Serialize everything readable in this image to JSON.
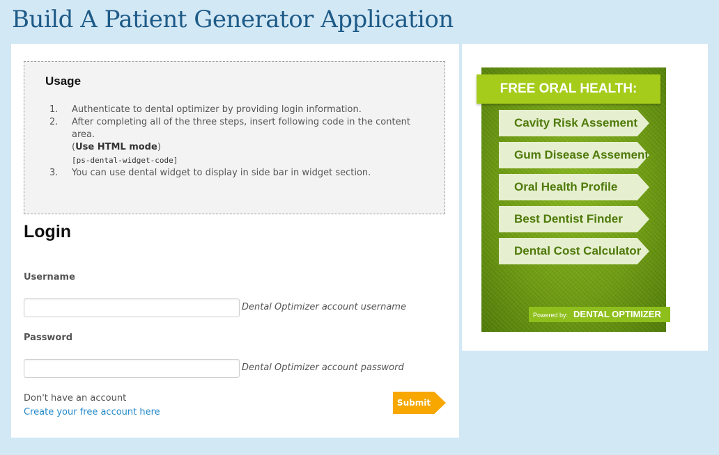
{
  "page": {
    "title": "Build A Patient Generator Application"
  },
  "usage": {
    "title": "Usage",
    "steps": [
      {
        "num": "1.",
        "text": "Authenticate to dental optimizer by providing login information."
      },
      {
        "num": "2.",
        "text": "After completing all of the three steps, insert following code in the content area.",
        "paren_open": "(",
        "bold": "Use HTML mode",
        "paren_close": ")",
        "code": "[ps-dental-widget-code]"
      },
      {
        "num": "3.",
        "text": "You can use dental widget to display in side bar in widget section."
      }
    ]
  },
  "login": {
    "heading": "Login",
    "username_label": "Username",
    "username_value": "",
    "username_hint": "Dental Optimizer account username",
    "password_label": "Password",
    "password_value": "",
    "password_hint": "Dental Optimizer account password",
    "no_account_text": "Don't have an account",
    "create_account_link": "Create your free account here",
    "submit_label": "Submit"
  },
  "widget": {
    "banner": "FREE ORAL HEALTH:",
    "items": [
      "Cavity Risk Assement",
      "Gum Disease Assement",
      "Oral Health Profile",
      "Best Dentist Finder",
      "Dental Cost Calculator"
    ],
    "powered_by": "Powered by:",
    "brand": "DENTAL OPTIMIZER"
  },
  "colors": {
    "background": "#d3e8f5",
    "title": "#1d5a87",
    "link": "#2389c8",
    "submit": "#f7a700",
    "widget_green": "#6e9b12",
    "widget_banner": "#a6cc1b"
  }
}
